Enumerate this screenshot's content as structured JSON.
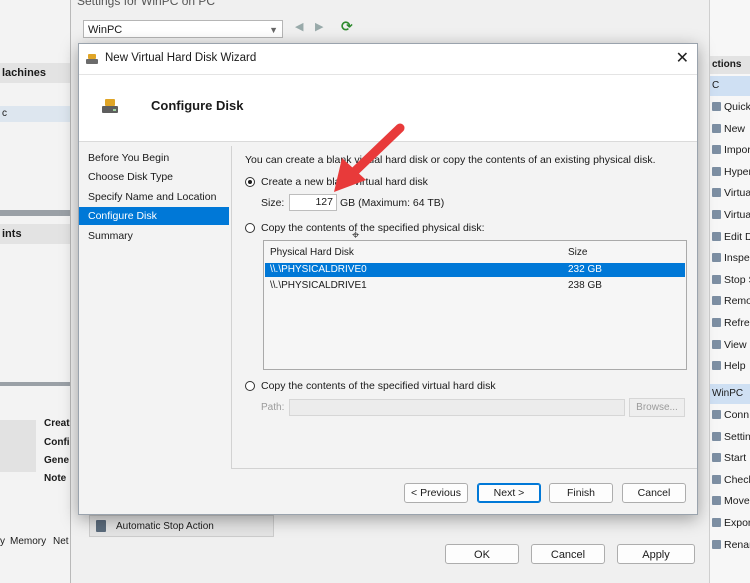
{
  "background": {
    "settings_title": "Settings for WinPC on PC",
    "vm_selector": "WinPC",
    "left_headers": [
      "lachines",
      "ints"
    ],
    "left_item": "c",
    "left_labels": [
      "Creat",
      "Confi",
      "Gene",
      "Note"
    ],
    "left_tabs": [
      "y",
      "Memory",
      "Net"
    ],
    "auto_stop_action": "Automatic Stop Action",
    "buttons": {
      "ok": "OK",
      "cancel": "Cancel",
      "apply": "Apply"
    },
    "actions_header": "ctions",
    "actions_group1": "C",
    "actions1": [
      "Quick",
      "New",
      "Impor",
      "Hyper",
      "Virtua",
      "Virtua",
      "Edit D",
      "Inspec",
      "Stop S",
      "Remo",
      "Refres",
      "View",
      "Help"
    ],
    "actions_group2": "WinPC",
    "actions2": [
      "Conn",
      "Settin",
      "Start",
      "Check",
      "Move",
      "Expor",
      "Renar"
    ]
  },
  "wizard": {
    "title": "New Virtual Hard Disk Wizard",
    "header": "Configure Disk",
    "steps": [
      "Before You Begin",
      "Choose Disk Type",
      "Specify Name and Location",
      "Configure Disk",
      "Summary"
    ],
    "active_step": "Configure Disk",
    "intro": "You can create a blank virtual hard disk or copy the contents of an existing physical disk.",
    "option_new": "Create a new blank virtual hard disk",
    "size_label": "Size:",
    "size_value": "127",
    "size_unit": "GB (Maximum: 64 TB)",
    "option_physical": "Copy the contents of the specified physical disk:",
    "disk_columns": {
      "name": "Physical Hard Disk",
      "size": "Size"
    },
    "disks": [
      {
        "name": "\\\\.\\PHYSICALDRIVE0",
        "size": "232 GB"
      },
      {
        "name": "\\\\.\\PHYSICALDRIVE1",
        "size": "238 GB"
      }
    ],
    "option_virtual": "Copy the contents of the specified virtual hard disk",
    "path_label": "Path:",
    "path_value": "",
    "browse": "Browse...",
    "buttons": {
      "previous": "< Previous",
      "next": "Next >",
      "finish": "Finish",
      "cancel": "Cancel"
    }
  },
  "colors": {
    "accent": "#0078d7",
    "annotation_arrow": "#e83a3a"
  }
}
